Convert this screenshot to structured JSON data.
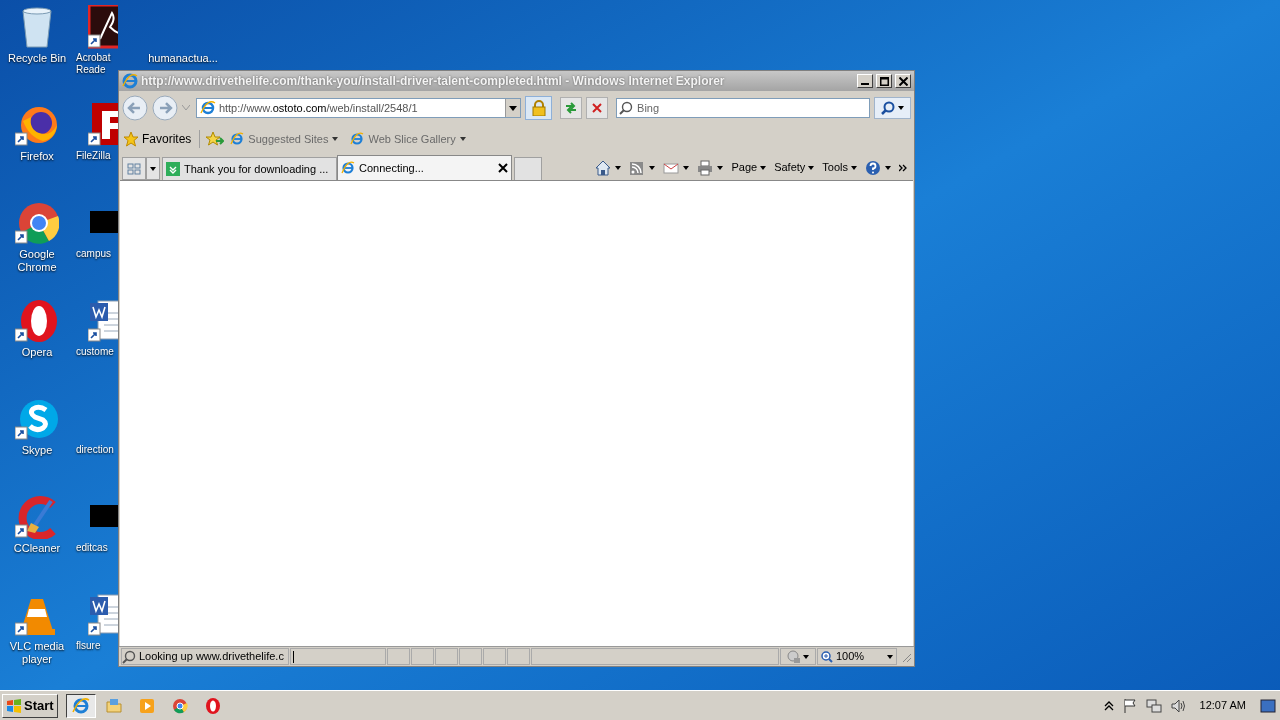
{
  "desktop": {
    "columns": [
      {
        "icons": [
          {
            "kind": "recycle",
            "label": "Recycle Bin"
          },
          {
            "kind": "firefox",
            "label": "Firefox"
          },
          {
            "kind": "chrome",
            "label": "Google Chrome"
          },
          {
            "kind": "opera",
            "label": "Opera"
          },
          {
            "kind": "skype",
            "label": "Skype"
          },
          {
            "kind": "ccleaner",
            "label": "CCleaner"
          },
          {
            "kind": "vlc",
            "label": "VLC media player"
          }
        ]
      },
      {
        "icons": [
          {
            "kind": "pdf",
            "label": "Acrobat Reade"
          },
          {
            "kind": "filezilla",
            "label": "FileZilla"
          },
          {
            "kind": "black",
            "label": "campus"
          },
          {
            "kind": "word",
            "label": "custome"
          },
          {
            "kind": "blank",
            "label": "direction"
          },
          {
            "kind": "black",
            "label": "editcas"
          },
          {
            "kind": "word",
            "label": "flsure"
          }
        ]
      },
      {
        "icons": [
          {
            "kind": "blank",
            "label": "humanactua..."
          }
        ]
      }
    ]
  },
  "window": {
    "title": "http://www.drivethelife.com/thank-you/install-driver-talent-completed.html - Windows Internet Explorer",
    "address": {
      "prefix": "http://www.",
      "domain": "ostoto.com",
      "path": "/web/install/2548/1"
    },
    "search": {
      "placeholder": "Bing"
    },
    "favorites": "Favorites",
    "favorites_links": [
      "Suggested Sites",
      "Web Slice Gallery"
    ],
    "tabs": [
      {
        "label": "Thank you for downloading ...",
        "kind": "site",
        "selected": false
      },
      {
        "label": "Connecting...",
        "kind": "ie",
        "selected": true
      }
    ],
    "commands": [
      "Page",
      "Safety",
      "Tools"
    ],
    "status": {
      "text": "Looking up www.drivethelife.c",
      "zoom": "100%"
    }
  },
  "taskbar": {
    "start": "Start",
    "apps": [
      {
        "kind": "ie",
        "selected": true
      },
      {
        "kind": "explorer",
        "selected": false
      },
      {
        "kind": "media",
        "selected": false
      },
      {
        "kind": "chrome",
        "selected": false
      },
      {
        "kind": "opera",
        "selected": false
      }
    ],
    "clock": "12:07 AM"
  }
}
